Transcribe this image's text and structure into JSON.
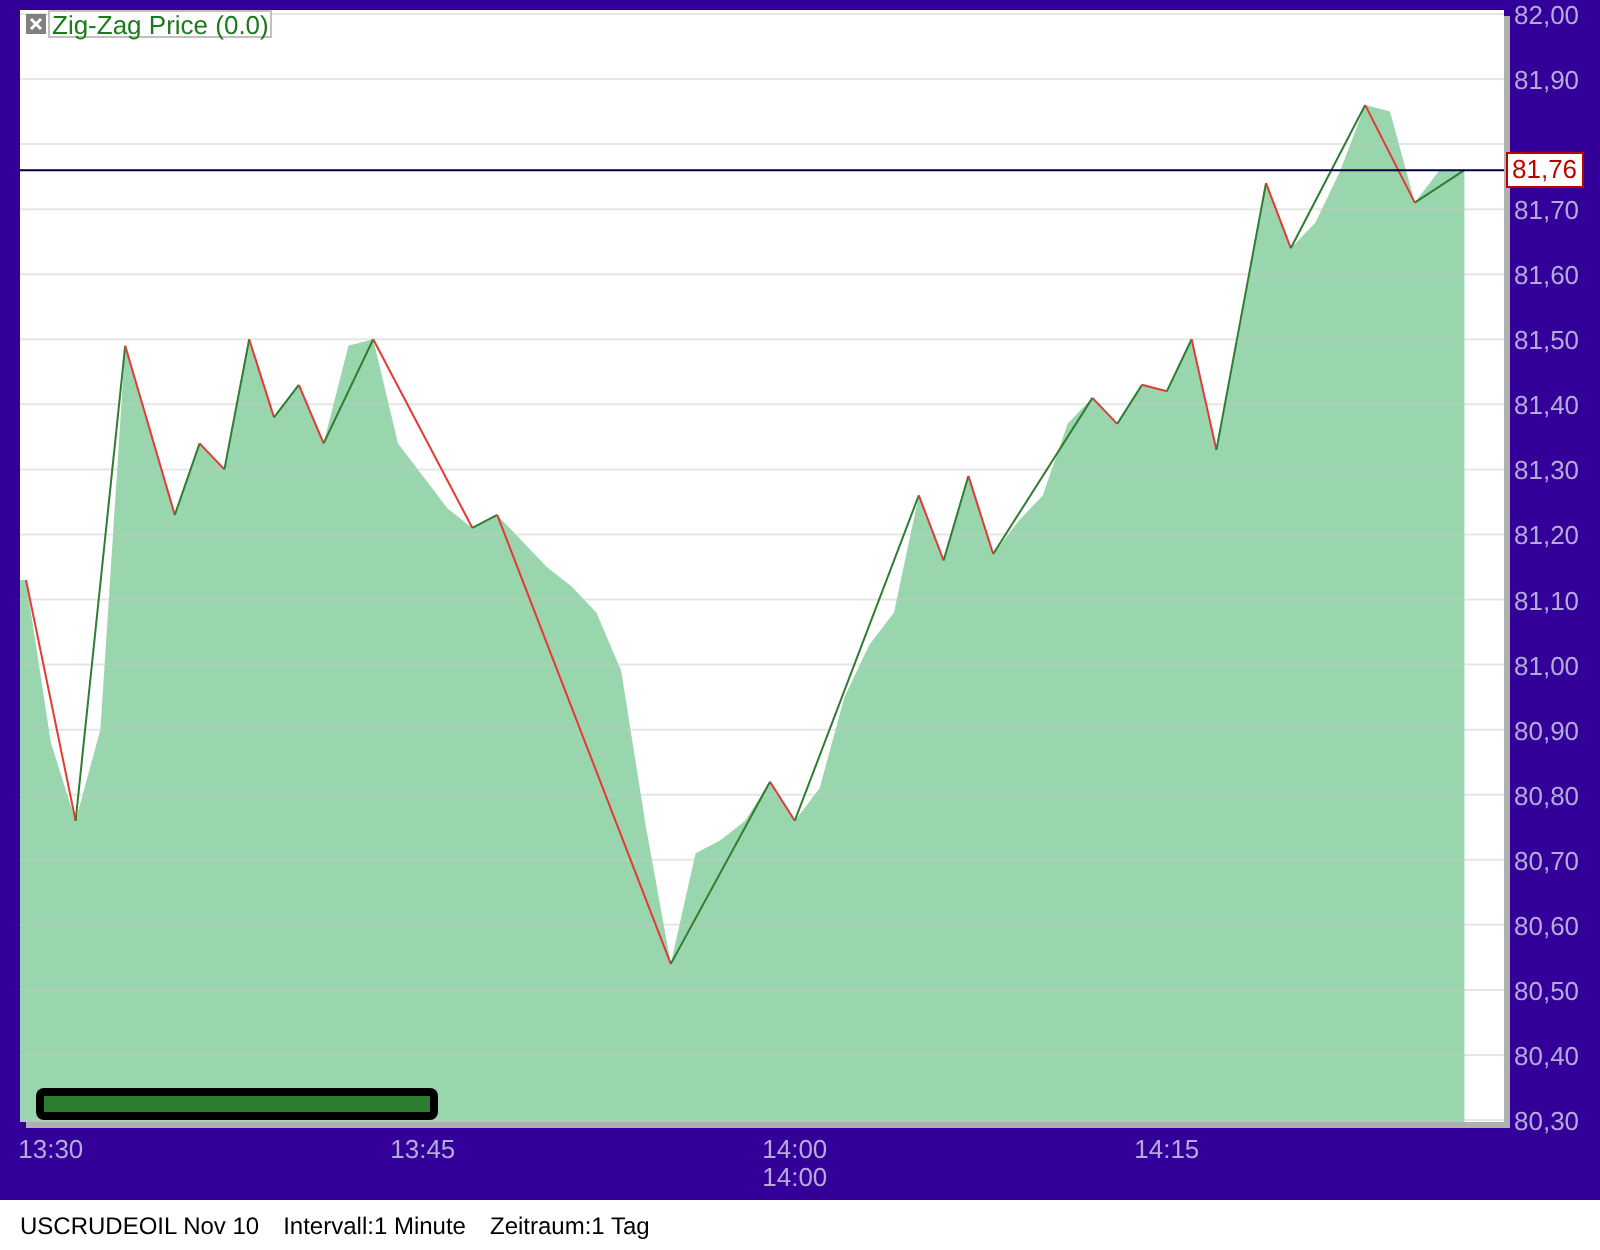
{
  "chart": {
    "legend": "Zig-Zag Price (0.0)",
    "chart_data": {
      "type": "area",
      "categories": [
        null,
        "13:30",
        null,
        null,
        null,
        null,
        null,
        null,
        null,
        null,
        null,
        null,
        null,
        null,
        null,
        null,
        "13:45",
        null,
        null,
        null,
        null,
        null,
        null,
        null,
        null,
        null,
        null,
        null,
        null,
        null,
        null,
        "14:00",
        null,
        null,
        null,
        null,
        null,
        null,
        null,
        null,
        null,
        null,
        null,
        null,
        null,
        null,
        "14:15",
        null,
        null,
        null,
        null,
        null,
        null,
        null,
        null,
        null,
        null,
        null,
        null
      ],
      "series": [
        {
          "color": "#99d6ad",
          "values": [
            81.13,
            80.88,
            80.76,
            80.9,
            81.49,
            81.36,
            81.23,
            81.34,
            81.3,
            81.5,
            81.38,
            81.43,
            81.34,
            81.49,
            81.5,
            81.34,
            81.29,
            81.24,
            81.21,
            81.23,
            81.19,
            81.15,
            81.12,
            81.08,
            80.99,
            80.75,
            80.54,
            80.71,
            80.73,
            80.76,
            80.82,
            80.76,
            80.81,
            80.95,
            81.03,
            81.08,
            81.26,
            81.16,
            81.29,
            81.17,
            81.22,
            81.26,
            81.37,
            81.41,
            81.37,
            81.43,
            81.42,
            81.5,
            81.33,
            81.53,
            81.74,
            81.64,
            81.68,
            81.76,
            81.86,
            81.85,
            81.71,
            81.76,
            81.76
          ]
        }
      ],
      "ylim": [
        80.3,
        82.0
      ],
      "grid": true,
      "yticks": [
        {
          "value": 80.3,
          "label": "80,30"
        },
        {
          "value": 80.4,
          "label": "80,40"
        },
        {
          "value": 80.5,
          "label": "80,50"
        },
        {
          "value": 80.6,
          "label": "80,60"
        },
        {
          "value": 80.7,
          "label": "80,70"
        },
        {
          "value": 80.8,
          "label": "80,80"
        },
        {
          "value": 80.9,
          "label": "80,90"
        },
        {
          "value": 81.0,
          "label": "81,00"
        },
        {
          "value": 81.1,
          "label": "81,10"
        },
        {
          "value": 81.2,
          "label": "81,20"
        },
        {
          "value": 81.3,
          "label": "81,30"
        },
        {
          "value": 81.4,
          "label": "81,40"
        },
        {
          "value": 81.5,
          "label": "81,50"
        },
        {
          "value": 81.6,
          "label": "81,60"
        },
        {
          "value": 81.7,
          "label": "81,70"
        },
        {
          "value": 81.9,
          "label": "81,90"
        },
        {
          "value": 82.0,
          "label": "82,00"
        }
      ]
    },
    "current_price": "81,76",
    "secondary_time_label": "14:00"
  },
  "status_bar": [
    "USCRUDEOIL Nov 10",
    "Intervall:1 Minute",
    "Zeitraum:1 Tag"
  ]
}
